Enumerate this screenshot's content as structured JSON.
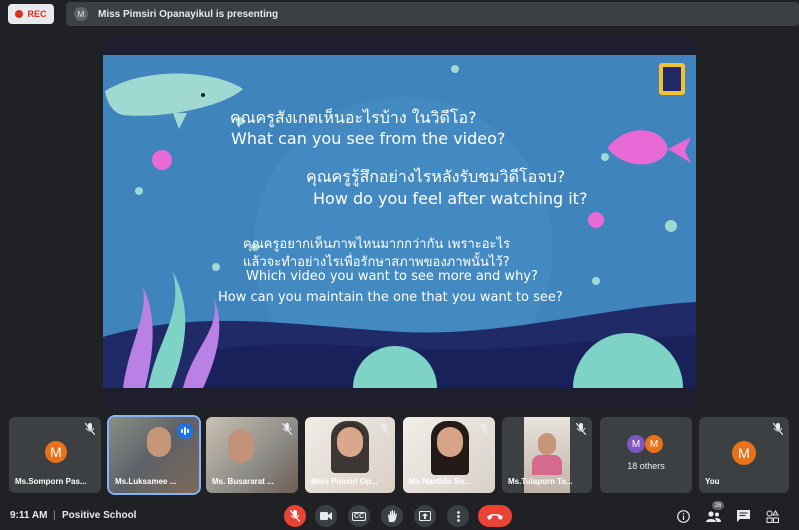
{
  "recording": {
    "label": "REC"
  },
  "presenting_bar": {
    "avatar_initial": "M",
    "text": "Miss Pimsiri Opanayikul is presenting"
  },
  "slide": {
    "q1_th": "คุณครูสังเกตเห็นอะไรบ้าง ในวิดีโอ?",
    "q1_en": "What can you see from the video?",
    "q2_th": "คุณครูรู้สึกอย่างไรหลังรับชมวิดีโอจบ?",
    "q2_en": "How do you feel after watching it?",
    "q3_th1": "คุณครูอยากเห็นภาพไหนมากกว่ากัน เพราะอะไร",
    "q3_th2": "แล้วจะทำอย่างไรเพื่อรักษาสภาพของภาพนั้นไว้?",
    "q3_en1": "Which video you want to see more and why?",
    "q3_en2": "How can you maintain the one that you want to see?"
  },
  "participants": [
    {
      "name": "Ms.Somporn Pas...",
      "initial": "M",
      "avatar_color": "#e8711a",
      "muted": true
    },
    {
      "name": "Ms.Luksamee ...",
      "speaking": true
    },
    {
      "name": "Ms. Busararat ...",
      "muted": true
    },
    {
      "name": "Miss Pimsiri Op...",
      "muted": true
    },
    {
      "name": "Ms.Nantida So...",
      "muted": true
    },
    {
      "name": "Ms.Tulaporn Ta...",
      "muted": true
    }
  ],
  "others_tile": {
    "initial_a": "M",
    "initial_b": "M",
    "label": "18 others"
  },
  "self_tile": {
    "name": "You",
    "initial": "M",
    "muted": true
  },
  "bottom_bar": {
    "time": "9:11 AM",
    "separator": "|",
    "meeting_name": "Positive School",
    "participants_count": "26"
  },
  "controls": [
    {
      "name": "mic-toggle",
      "state": "off"
    },
    {
      "name": "camera-toggle"
    },
    {
      "name": "captions-toggle",
      "label": "CC"
    },
    {
      "name": "raise-hand"
    },
    {
      "name": "present-now"
    },
    {
      "name": "more-options"
    },
    {
      "name": "leave-call"
    }
  ],
  "colors": {
    "accent_red": "#ea4335",
    "slide_blue": "#3a7fb8",
    "active_outline": "#8ab4f8"
  }
}
